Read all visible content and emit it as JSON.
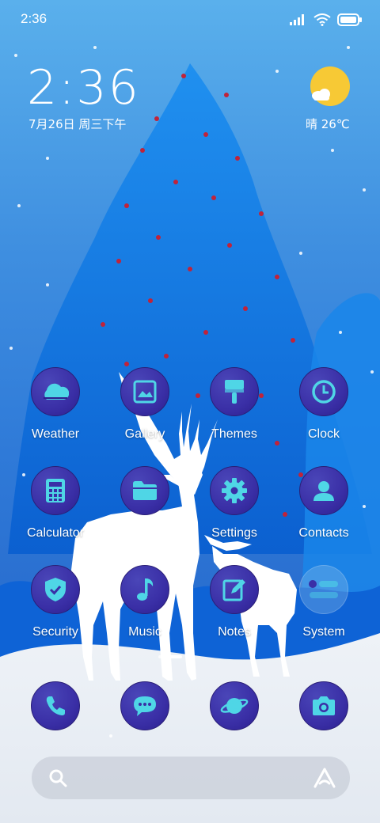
{
  "status_bar": {
    "time": "2:36",
    "icons": [
      "signal-icon",
      "wifi-icon",
      "battery-icon"
    ]
  },
  "clock_widget": {
    "time": "2:36",
    "date": "7月26日 周三下午",
    "weather": "晴 26℃",
    "weather_icon": "sun-cloud-icon"
  },
  "apps": [
    {
      "label": "Weather",
      "icon": "weather-icon"
    },
    {
      "label": "Gallery",
      "icon": "gallery-icon"
    },
    {
      "label": "Themes",
      "icon": "themes-icon"
    },
    {
      "label": "Clock",
      "icon": "clock-icon"
    },
    {
      "label": "Calculator",
      "icon": "calculator-icon"
    },
    {
      "label": "",
      "icon": "folder-icon"
    },
    {
      "label": "Settings",
      "icon": "settings-icon"
    },
    {
      "label": "Contacts",
      "icon": "contacts-icon"
    },
    {
      "label": "Security",
      "icon": "security-icon"
    },
    {
      "label": "Music",
      "icon": "music-icon"
    },
    {
      "label": "Notes",
      "icon": "notes-icon"
    },
    {
      "label": "System",
      "icon": "system-icon"
    }
  ],
  "dock": [
    {
      "icon": "phone-icon"
    },
    {
      "icon": "messages-icon"
    },
    {
      "icon": "browser-icon"
    },
    {
      "icon": "camera-icon"
    }
  ],
  "search_bar": {
    "search_icon": "search-icon",
    "assistant_icon": "assistant-icon"
  },
  "colors": {
    "icon_glyph": "#4fd6e6",
    "icon_bg": "#3a2fa6",
    "sun": "#f7c935"
  }
}
